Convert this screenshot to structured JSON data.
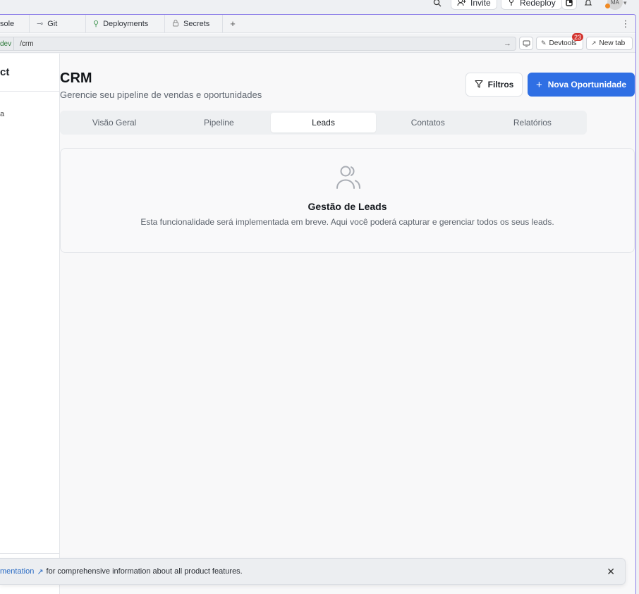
{
  "topbar": {
    "invite_label": "Invite",
    "redeploy_label": "Redeploy",
    "avatar_initials": "MA"
  },
  "tabs": [
    {
      "label": "sole"
    },
    {
      "label": "Git"
    },
    {
      "label": "Deployments"
    },
    {
      "label": "Secrets"
    }
  ],
  "url": {
    "env": "dev",
    "path": "/crm",
    "devtools_label": "Devtools",
    "devtools_badge": "23",
    "newtab_label": "New tab"
  },
  "sidebar": {
    "title": "ct",
    "item": "a"
  },
  "page": {
    "title": "CRM",
    "subtitle": "Gerencie seu pipeline de vendas e oportunidades",
    "filter_label": "Filtros",
    "primary_label": "Nova Oportunidade"
  },
  "segments": [
    {
      "label": "Visão Geral"
    },
    {
      "label": "Pipeline"
    },
    {
      "label": "Leads"
    },
    {
      "label": "Contatos"
    },
    {
      "label": "Relatórios"
    }
  ],
  "active_segment": "Leads",
  "card": {
    "title": "Gestão de Leads",
    "description": "Esta funcionalidade será implementada em breve. Aqui você poderá capturar e gerenciar todos os seus leads."
  },
  "toast": {
    "link_text": "mentation",
    "text": "for comprehensive information about all product features."
  },
  "colors": {
    "primary": "#2f6fe4",
    "frame_border": "#8c7ee8",
    "badge": "#d3342f"
  }
}
